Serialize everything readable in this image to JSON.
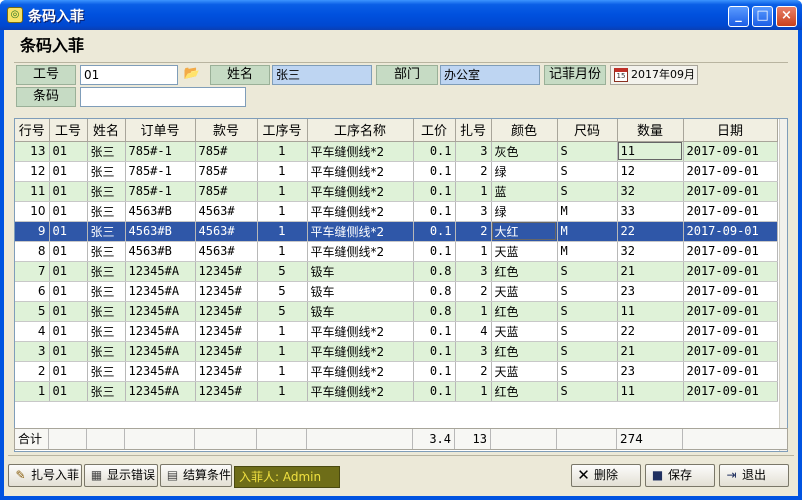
{
  "window": {
    "title": "条码入菲",
    "app_icon": "app-icon",
    "min": "_",
    "max": "□",
    "close": "×"
  },
  "heading": "条码入菲",
  "form": {
    "gonghao_label": "工号",
    "gonghao_value": "01",
    "name_label": "姓名",
    "name_value": "张三",
    "dept_label": "部门",
    "dept_value": "办公室",
    "month_label": "记菲月份",
    "month_value": "2017年09月",
    "barcode_label": "条码",
    "barcode_value": ""
  },
  "table": {
    "columns": [
      "行号",
      "工号",
      "姓名",
      "订单号",
      "款号",
      "工序号",
      "工序名称",
      "工价",
      "扎号",
      "颜色",
      "尺码",
      "数量",
      "日期"
    ],
    "rows": [
      [
        "13",
        "01",
        "张三",
        "785#-1",
        "785#",
        "1",
        "平车缝侧线*2",
        "0.1",
        "3",
        "灰色",
        "S",
        "11",
        "2017-09-01"
      ],
      [
        "12",
        "01",
        "张三",
        "785#-1",
        "785#",
        "1",
        "平车缝侧线*2",
        "0.1",
        "2",
        "绿",
        "S",
        "12",
        "2017-09-01"
      ],
      [
        "11",
        "01",
        "张三",
        "785#-1",
        "785#",
        "1",
        "平车缝侧线*2",
        "0.1",
        "1",
        "蓝",
        "S",
        "32",
        "2017-09-01"
      ],
      [
        "10",
        "01",
        "张三",
        "4563#B",
        "4563#",
        "1",
        "平车缝侧线*2",
        "0.1",
        "3",
        "绿",
        "M",
        "33",
        "2017-09-01"
      ],
      [
        "9",
        "01",
        "张三",
        "4563#B",
        "4563#",
        "1",
        "平车缝侧线*2",
        "0.1",
        "2",
        "大红",
        "M",
        "22",
        "2017-09-01"
      ],
      [
        "8",
        "01",
        "张三",
        "4563#B",
        "4563#",
        "1",
        "平车缝侧线*2",
        "0.1",
        "1",
        "天蓝",
        "M",
        "32",
        "2017-09-01"
      ],
      [
        "7",
        "01",
        "张三",
        "12345#A",
        "12345#",
        "5",
        "钑车",
        "0.8",
        "3",
        "红色",
        "S",
        "21",
        "2017-09-01"
      ],
      [
        "6",
        "01",
        "张三",
        "12345#A",
        "12345#",
        "5",
        "钑车",
        "0.8",
        "2",
        "天蓝",
        "S",
        "23",
        "2017-09-01"
      ],
      [
        "5",
        "01",
        "张三",
        "12345#A",
        "12345#",
        "5",
        "钑车",
        "0.8",
        "1",
        "红色",
        "S",
        "11",
        "2017-09-01"
      ],
      [
        "4",
        "01",
        "张三",
        "12345#A",
        "12345#",
        "1",
        "平车缝侧线*2",
        "0.1",
        "4",
        "天蓝",
        "S",
        "22",
        "2017-09-01"
      ],
      [
        "3",
        "01",
        "张三",
        "12345#A",
        "12345#",
        "1",
        "平车缝侧线*2",
        "0.1",
        "3",
        "红色",
        "S",
        "21",
        "2017-09-01"
      ],
      [
        "2",
        "01",
        "张三",
        "12345#A",
        "12345#",
        "1",
        "平车缝侧线*2",
        "0.1",
        "2",
        "天蓝",
        "S",
        "23",
        "2017-09-01"
      ],
      [
        "1",
        "01",
        "张三",
        "12345#A",
        "12345#",
        "1",
        "平车缝侧线*2",
        "0.1",
        "1",
        "红色",
        "S",
        "11",
        "2017-09-01"
      ]
    ],
    "selected_row": 4,
    "totals": {
      "label": "合计",
      "price": "3.4",
      "bundle": "13",
      "qty": "274"
    }
  },
  "toolbar": {
    "bundle_entry": "扎号入菲",
    "show_errors": "显示错误",
    "settle_conditions": "结算条件",
    "operator": "入菲人: Admin",
    "delete": "删除",
    "save": "保存",
    "exit": "退出"
  }
}
